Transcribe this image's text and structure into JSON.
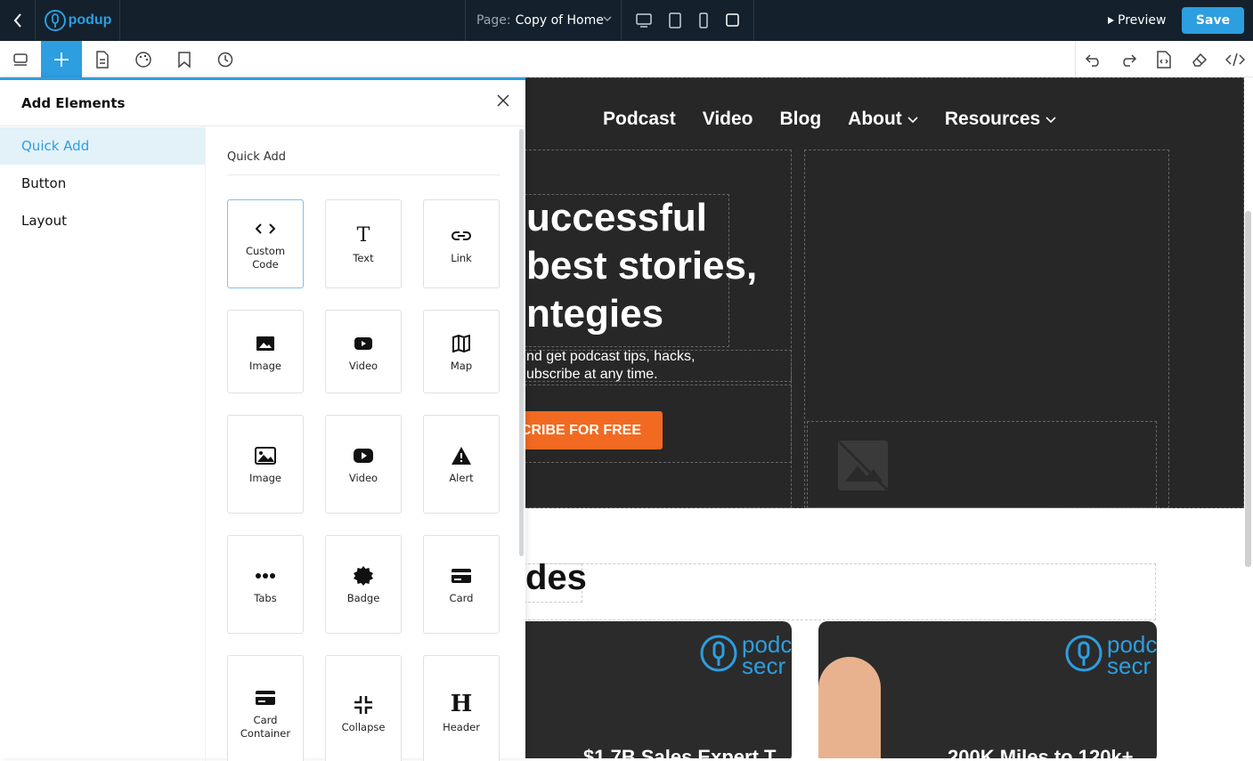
{
  "topbar": {
    "logo_text": "podup",
    "page_label": "Page:",
    "page_value": "Copy of Home",
    "preview_label": "Preview",
    "save_label": "Save"
  },
  "canvas": {
    "nav": [
      "Podcast",
      "Video",
      "Blog",
      "About",
      "Resources"
    ],
    "hero_title_lines": [
      "uccessful",
      "best stories,",
      "ntegies"
    ],
    "hero_sub_lines": [
      "nd get podcast tips, hacks,",
      "ubscribe at any time."
    ],
    "hero_button": "BSCRIBE FOR FREE",
    "episodes_title": "des",
    "card1_logo": "podc secr",
    "card1_title": "$1.7B Sales Expert T",
    "card2_logo": "podc secr",
    "card2_title": "200K Miles to 120k+"
  },
  "panel": {
    "title": "Add Elements",
    "nav": [
      {
        "label": "Quick Add",
        "active": true
      },
      {
        "label": "Button",
        "active": false
      },
      {
        "label": "Layout",
        "active": false
      }
    ],
    "section_title": "Quick Add",
    "tiles": [
      {
        "label": "Custom Code",
        "icon": "code-icon"
      },
      {
        "label": "Text",
        "icon": "text-icon"
      },
      {
        "label": "Link",
        "icon": "link-icon"
      },
      {
        "label": "Image",
        "icon": "image-icon"
      },
      {
        "label": "Video",
        "icon": "video-icon"
      },
      {
        "label": "Map",
        "icon": "map-icon"
      },
      {
        "label": "Image",
        "icon": "image-icon"
      },
      {
        "label": "Video",
        "icon": "video-icon"
      },
      {
        "label": "Alert",
        "icon": "alert-icon"
      },
      {
        "label": "Tabs",
        "icon": "tabs-icon"
      },
      {
        "label": "Badge",
        "icon": "badge-icon"
      },
      {
        "label": "Card",
        "icon": "card-icon"
      },
      {
        "label": "Card Container",
        "icon": "card-container-icon"
      },
      {
        "label": "Collapse",
        "icon": "collapse-icon"
      },
      {
        "label": "Header",
        "icon": "header-icon"
      }
    ]
  },
  "colors": {
    "accent": "#2d9ee0",
    "topbar": "#14212d",
    "hero_bg": "#272727",
    "cta": "#f26a21"
  }
}
